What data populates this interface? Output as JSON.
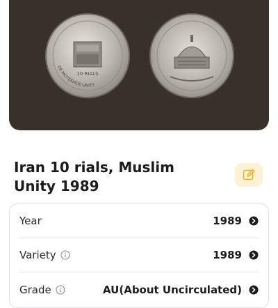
{
  "coin": {
    "title": "Iran 10 rials, Muslim Unity 1989"
  },
  "details": [
    {
      "label": "Year",
      "value": "1989",
      "has_info": false
    },
    {
      "label": "Variety",
      "value": "1989",
      "has_info": true
    },
    {
      "label": "Grade",
      "value": "AU(About Uncirculated)",
      "has_info": true
    }
  ],
  "coin_markings": {
    "obverse_denomination": "10 RIALS",
    "obverse_legend": "DE MOTEEMOE-UNITY"
  },
  "colors": {
    "photo_bg": "#3a302a",
    "edit_accent": "#e8b22a",
    "edit_bg": "#fdf2d6"
  }
}
